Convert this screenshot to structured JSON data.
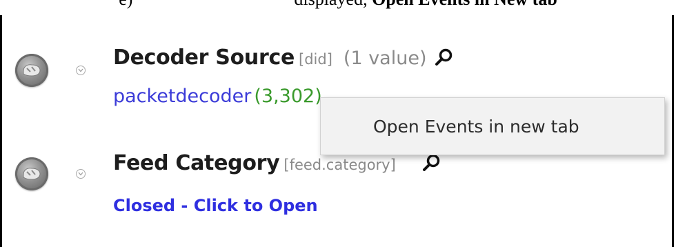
{
  "caption": {
    "before": "e) ",
    "middle": "                                   displayed, ",
    "bold": "Open Events in New tab"
  },
  "groups": [
    {
      "title": "Decoder Source",
      "key": "[did]",
      "count": "(1 value)",
      "value": "packetdecoder",
      "value_count": "(3,302)"
    },
    {
      "title": "Feed Category",
      "key": "[feed.category]",
      "closed_text": "Closed - Click to Open"
    }
  ],
  "context_menu": {
    "item": "Open Events in new tab"
  }
}
